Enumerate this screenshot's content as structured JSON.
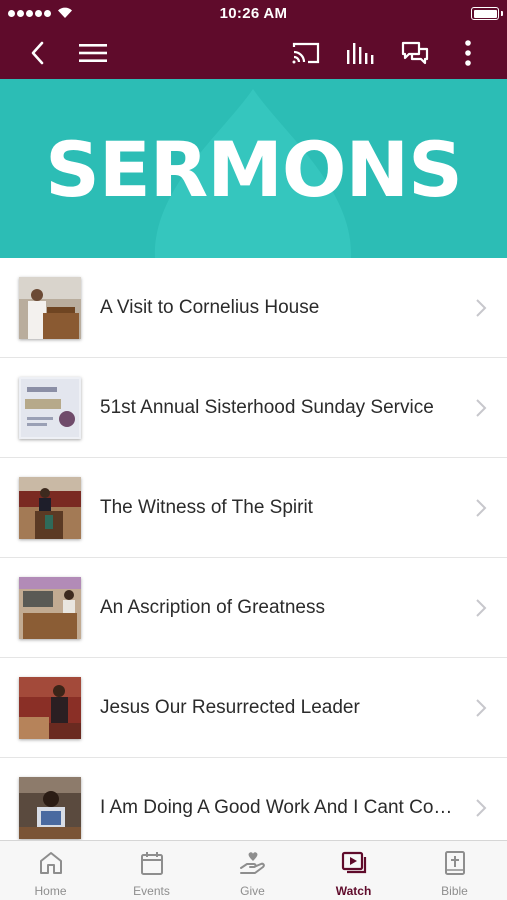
{
  "status_bar": {
    "time": "10:26 AM"
  },
  "nav_bar": {
    "icons": [
      "back-icon",
      "menu-icon",
      "cast-icon",
      "audio-bars-icon",
      "chat-icon",
      "more-icon"
    ],
    "color": "#5f0b2b"
  },
  "banner": {
    "title": "SERMONS",
    "color": "#2cbdb5"
  },
  "sermons": [
    {
      "title": "A Visit to Cornelius House"
    },
    {
      "title": "51st Annual Sisterhood Sunday Service"
    },
    {
      "title": "The Witness of The Spirit"
    },
    {
      "title": "An Ascription of Greatness"
    },
    {
      "title": "Jesus Our Resurrected Leader"
    },
    {
      "title": "I Am Doing A Good Work And I Cant Come Down"
    }
  ],
  "tabs": [
    {
      "label": "Home",
      "icon": "home-icon"
    },
    {
      "label": "Events",
      "icon": "calendar-icon"
    },
    {
      "label": "Give",
      "icon": "give-icon"
    },
    {
      "label": "Watch",
      "icon": "video-icon",
      "active": true
    },
    {
      "label": "Bible",
      "icon": "bible-icon"
    }
  ],
  "colors": {
    "accent": "#5f0b2b",
    "inactive_tab": "#8e8e8e"
  }
}
